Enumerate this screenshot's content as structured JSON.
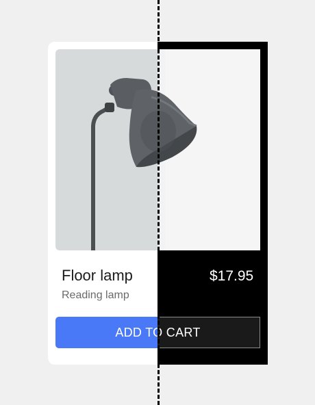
{
  "product": {
    "title": "Floor lamp",
    "subtitle": "Reading lamp",
    "price": "$17.95",
    "image_subject": "grey-floor-lamp"
  },
  "button": {
    "label": "ADD TO CART"
  },
  "colors": {
    "background": "#f0f0f0",
    "card_light": "#ffffff",
    "card_dark": "#000000",
    "button_light": "#4a79f7",
    "button_dark": "#1a1a1a",
    "lamp": "#54585b"
  },
  "comparison_divider": {
    "style": "dashed"
  }
}
